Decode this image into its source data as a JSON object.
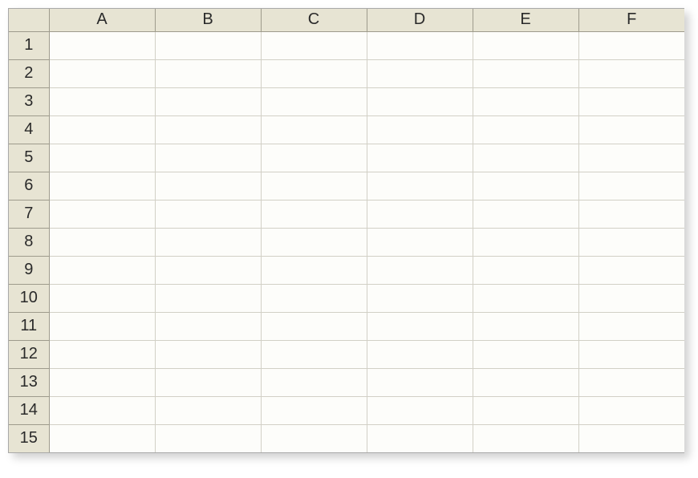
{
  "spreadsheet": {
    "columns": [
      "A",
      "B",
      "C",
      "D",
      "E",
      "F"
    ],
    "rows": [
      "1",
      "2",
      "3",
      "4",
      "5",
      "6",
      "7",
      "8",
      "9",
      "10",
      "11",
      "12",
      "13",
      "14",
      "15"
    ],
    "cells": {
      "A1": "",
      "B1": "",
      "C1": "",
      "D1": "",
      "E1": "",
      "F1": "",
      "A2": "",
      "B2": "",
      "C2": "",
      "D2": "",
      "E2": "",
      "F2": "",
      "A3": "",
      "B3": "",
      "C3": "",
      "D3": "",
      "E3": "",
      "F3": "",
      "A4": "",
      "B4": "",
      "C4": "",
      "D4": "",
      "E4": "",
      "F4": "",
      "A5": "",
      "B5": "",
      "C5": "",
      "D5": "",
      "E5": "",
      "F5": "",
      "A6": "",
      "B6": "",
      "C6": "",
      "D6": "",
      "E6": "",
      "F6": "",
      "A7": "",
      "B7": "",
      "C7": "",
      "D7": "",
      "E7": "",
      "F7": "",
      "A8": "",
      "B8": "",
      "C8": "",
      "D8": "",
      "E8": "",
      "F8": "",
      "A9": "",
      "B9": "",
      "C9": "",
      "D9": "",
      "E9": "",
      "F9": "",
      "A10": "",
      "B10": "",
      "C10": "",
      "D10": "",
      "E10": "",
      "F10": "",
      "A11": "",
      "B11": "",
      "C11": "",
      "D11": "",
      "E11": "",
      "F11": "",
      "A12": "",
      "B12": "",
      "C12": "",
      "D12": "",
      "E12": "",
      "F12": "",
      "A13": "",
      "B13": "",
      "C13": "",
      "D13": "",
      "E13": "",
      "F13": "",
      "A14": "",
      "B14": "",
      "C14": "",
      "D14": "",
      "E14": "",
      "F14": "",
      "A15": "",
      "B15": "",
      "C15": "",
      "D15": "",
      "E15": "",
      "F15": ""
    }
  }
}
